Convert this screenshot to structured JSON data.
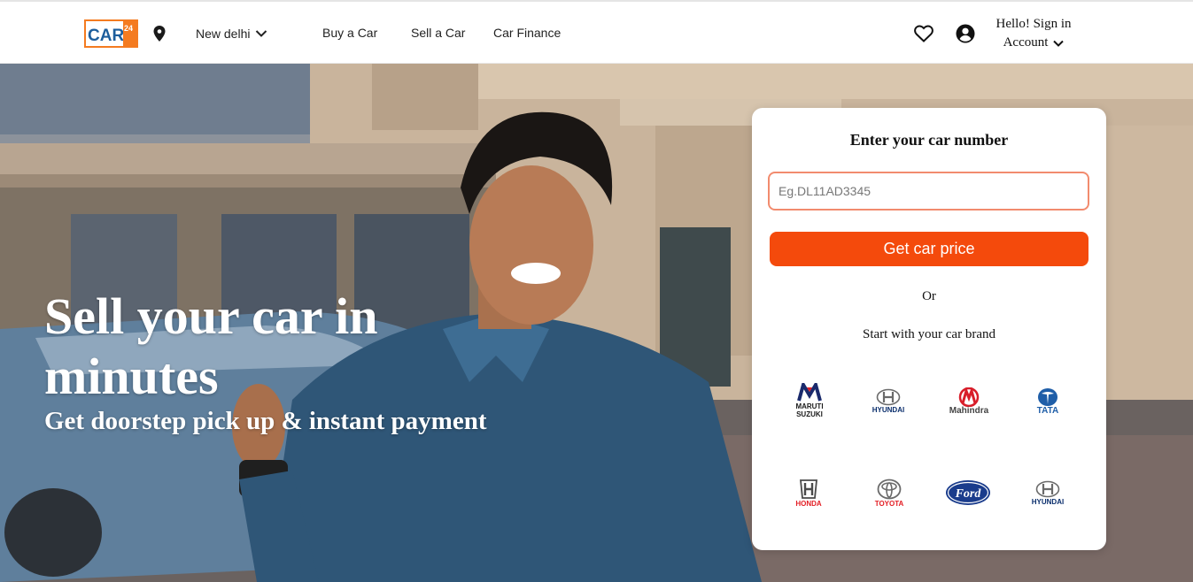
{
  "header": {
    "logo_text": "CARS",
    "logo_badge": "24",
    "city": "New delhi",
    "nav": [
      "Buy a Car",
      "Sell a Car",
      "Car Finance"
    ],
    "signin_line1": "Hello! Sign in",
    "signin_line2": "Account",
    "icons": [
      "location-pin-icon",
      "chevron-down-icon",
      "heart-icon",
      "account-icon"
    ]
  },
  "hero": {
    "title": "Sell your car in minutes",
    "subtitle": "Get doorstep pick up & instant payment"
  },
  "card": {
    "title": "Enter your car number",
    "input_placeholder": "Eg.DL11AD3345",
    "input_value": "",
    "cta_label": "Get car price",
    "or_text": "Or",
    "brand_heading": "Start with your car brand",
    "brands": [
      {
        "name": "Maruti Suzuki",
        "label": "MARUTI\nSUZUKI"
      },
      {
        "name": "Hyundai",
        "label": "HYUNDAI"
      },
      {
        "name": "Mahindra",
        "label": "Mahindra"
      },
      {
        "name": "Tata",
        "label": "TATA"
      },
      {
        "name": "Honda",
        "label": "HONDA"
      },
      {
        "name": "Toyota",
        "label": "TOYOTA"
      },
      {
        "name": "Ford",
        "label": "Ford"
      },
      {
        "name": "Hyundai",
        "label": "HYUNDAI"
      }
    ]
  },
  "colors": {
    "accent": "#f44a0c",
    "input_border": "#f28b6e",
    "logo_blue": "#1d5e9c",
    "logo_orange": "#f47b20"
  }
}
